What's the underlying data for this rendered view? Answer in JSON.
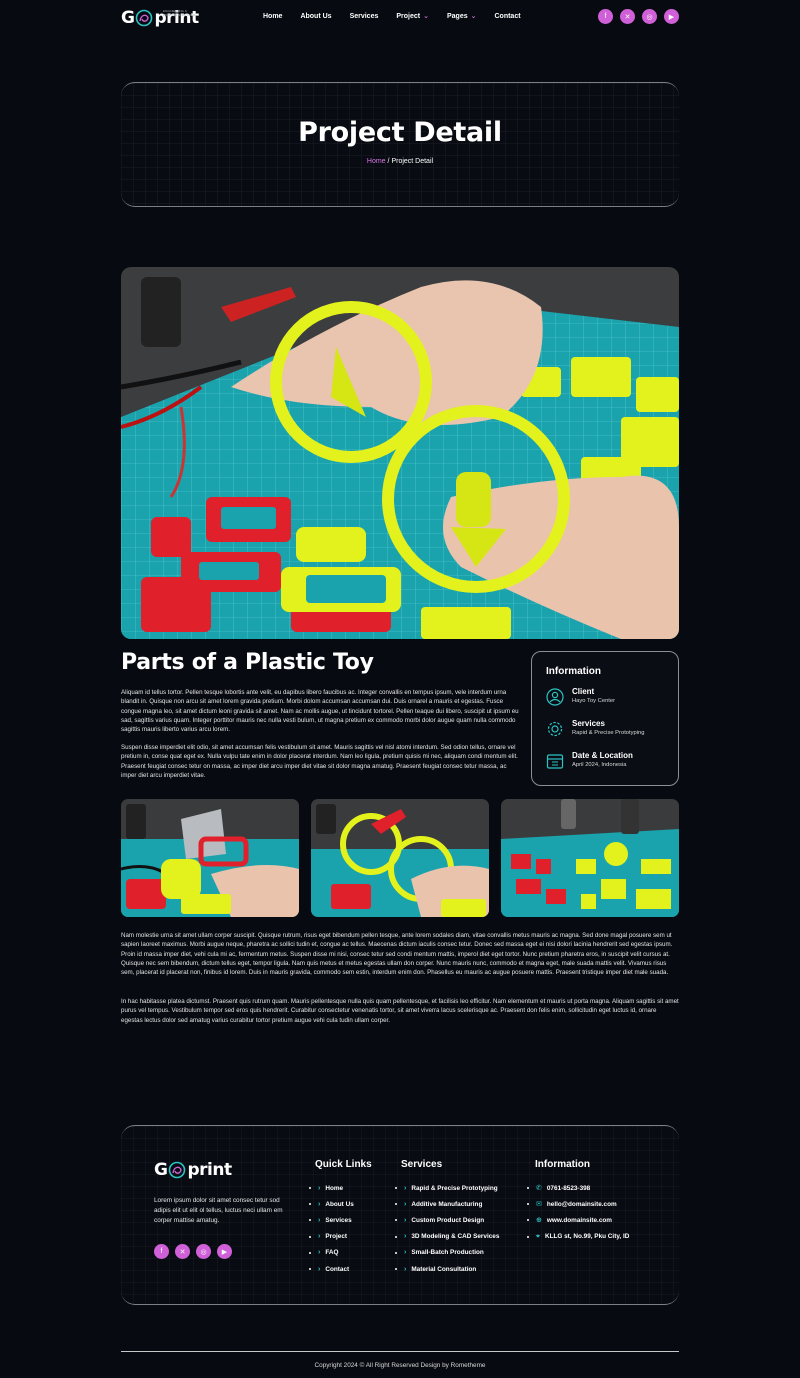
{
  "brand": {
    "name_prefix": "G",
    "name_suffix": "print",
    "tagline": "ENGINEERING & PRINTING SOLUTIONS"
  },
  "nav": {
    "items": [
      {
        "label": "Home"
      },
      {
        "label": "About Us"
      },
      {
        "label": "Services"
      },
      {
        "label": "Project",
        "dropdown": true
      },
      {
        "label": "Pages",
        "dropdown": true
      },
      {
        "label": "Contact"
      }
    ],
    "socials": [
      "facebook-icon",
      "x-icon",
      "instagram-icon",
      "youtube-icon"
    ]
  },
  "hero": {
    "title": "Project Detail",
    "breadcrumb_home": "Home",
    "breadcrumb_sep": " / ",
    "breadcrumb_current": "Project Detail"
  },
  "project": {
    "title": "Parts of a Plastic Toy",
    "paragraph1": "Aliquam id tellus tortor. Pellen tesque lobortis ante velit, eu dapibus libero faucibus ac. Integer convallis en tempus ipsum, vele interdum urna blandit in. Quisque non arcu sit amet lorem gravida pretium. Morbi dolom accumsan accumsan dui. Duis ornarel a mauris et egestas. Fusce congue magna leo, sit amet dictum leoni gravida sit amet. Nam ac mollis augue, ut tincidunt tortorel. Pellen teaque dui libero, suscipit ut ipsum eu sad, sagittis varius quam. Integer porttitor mauris nec nulla vesti bulum, ut magna pretium ex commodo morbi dolor augue quam nulla commodo sagittis mauris liberto varius arcu lorem.",
    "paragraph2": "Suspen disse imperdiet elit odio, sit amet accumsan felis vestibulum sit amet. Mauris sagittis vel nisl atomi interdum. Sed odion tellus, ornare vel pretium in, conse quat eget ex. Nulla vulpu tate enim in dolor placerat interdum. Nam leo ligula, pretium quisis mi nec, aliquam condi mentum elit. Praesent feugiat consec tetur on massa, ac imper diet arcu imper diet vitae sit dolor magna amatug. Praesent feugiat consec tetur massa, ac imper diet arcu imperdiet vitae.",
    "paragraph3": "Nam molestie urna sit amet ullam corper suscipit. Quisque rutrum, risus eget bibendum pellen tesque, ante lorem sodales diam, vitae convallis metus mauris ac magna. Sed done magal posuere sem ut sapien laoreet maximus. Morbi augue neque, pharetra ac sollici tudin et, congue ac tellus. Maecenas dictum iaculis consec tetur. Donec sed massa eget ei nisi dolori lacinia hendrerit sed egestas ipsum. Proin id massa imper diet, vehi cula mi ac, fermentum metus. Suspen disse mi nisi, consec tetur sed condi mentum mattis, imperol diet eget tortor. Nunc pretium pharetra eros, in suscipit velit cursus at. Quisque nec sem bibendum, dictum tellus eget, tempor ligula. Nam quis metus et metus egestas ullam don corper. Nunc mauris nunc, commodo et magna eget, male suada mattis velit. Vivamus risus sem, placerat id placerat non, finibus id lorem. Duis in mauris gravida, commodo sem estin, interdum enim don. Phasellus eu mauris ac augue posuere mattis. Praesent tristique imper diet male suada.",
    "paragraph4": "In hac habitasse platea dictumst. Praesent quis rutrum quam. Mauris pellentesque nulla quis quam pellentesque, et facilisis leo efficitur. Nam elementum et mauris ut porta magna. Aliquam sagittis sit amet purus vel tempus. Vestibulum tempor sed eros quis hendrerit. Curabitur consectetur venenatis tortor, sit amet viverra lacus scelerisque ac. Praesent don felis enim, sollicitudin eget luctus id, ornare egestas lectus dolor sed amatug varius curabitur tortor pretium augue vehi cula tudin ullam corper."
  },
  "info": {
    "title": "Information",
    "rows": [
      {
        "label": "Client",
        "value": "Hayo Toy Center",
        "icon": "user-icon"
      },
      {
        "label": "Services",
        "value": "Rapid & Precise Prototyping",
        "icon": "gear-icon"
      },
      {
        "label": "Date & Location",
        "value": "April 2024, Indonesia",
        "icon": "calendar-icon"
      }
    ]
  },
  "footer": {
    "description": "Lorem ipsum dolor sit amet consec tetur sod adipis elit ut elit ol tellus, luctus neci ullam em corper mattise amatug.",
    "quick_links_title": "Quick Links",
    "quick_links": [
      "Home",
      "About Us",
      "Services",
      "Project",
      "FAQ",
      "Contact"
    ],
    "services_title": "Services",
    "services": [
      "Rapid & Precise Prototyping",
      "Additive Manufacturing",
      "Custom Product Design",
      "3D Modeling & CAD Services",
      "Small-Batch Production",
      "Material Consultation"
    ],
    "information_title": "Information",
    "information": [
      {
        "value": "0761-8523-398",
        "icon": "phone-icon"
      },
      {
        "value": "hello@domainsite.com",
        "icon": "mail-icon"
      },
      {
        "value": "www.domainsite.com",
        "icon": "globe-icon"
      },
      {
        "value": "KLLG st, No.99, Pku City, ID",
        "icon": "location-icon"
      }
    ],
    "copyright": "Copyright 2024 © All Right Reserved Design by Rometheme"
  },
  "colors": {
    "accent": "#d060d8",
    "teal": "#2bc4c4",
    "background": "#070a10"
  }
}
